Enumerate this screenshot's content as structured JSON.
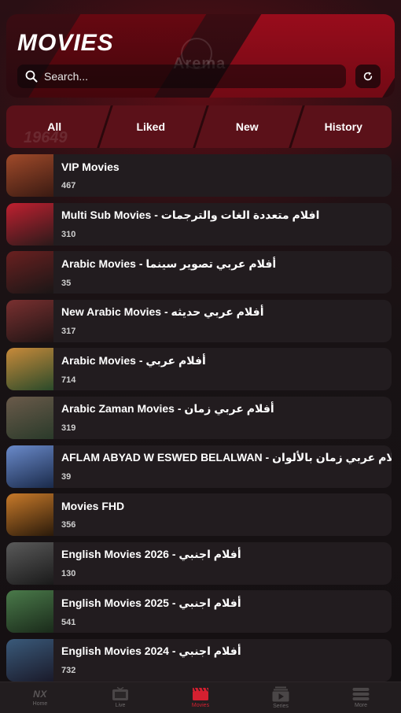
{
  "header": {
    "title": "MOVIES",
    "watermark": "Arema",
    "search_placeholder": "Search..."
  },
  "tabs": [
    {
      "label": "All"
    },
    {
      "label": "Liked"
    },
    {
      "label": "New"
    },
    {
      "label": "History"
    }
  ],
  "tabs_ghost_number": "19649",
  "categories": [
    {
      "title": "VIP Movies",
      "count": "467",
      "thumb": [
        "#3a1a12",
        "#a04a2a"
      ]
    },
    {
      "title": "Multi Sub Movies - افلام متعددة الغات والترجمات",
      "count": "310",
      "thumb": [
        "#2b1a1a",
        "#c02030"
      ]
    },
    {
      "title": "Arabic Movies - أفلام عربي تصوير سينما",
      "count": "35",
      "thumb": [
        "#1a1616",
        "#6a2020"
      ]
    },
    {
      "title": "New Arabic Movies - أفلام عربي حديثه",
      "count": "317",
      "thumb": [
        "#1e1414",
        "#7a3030"
      ]
    },
    {
      "title": "Arabic Movies - أفلام عربي",
      "count": "714",
      "thumb": [
        "#2a4a2a",
        "#c88a3a"
      ]
    },
    {
      "title": "Arabic Zaman Movies - أفلام عربي زمان",
      "count": "319",
      "thumb": [
        "#2a3a2a",
        "#6a5a4a"
      ]
    },
    {
      "title": "AFLAM ABYAD W ESWED BELALWAN - أفلام عربي زمان بالألوان",
      "count": "39",
      "thumb": [
        "#1a2a4a",
        "#6a8aca"
      ]
    },
    {
      "title": "Movies FHD",
      "count": "356",
      "thumb": [
        "#2a1a0a",
        "#c87a2a"
      ]
    },
    {
      "title": "English Movies 2026 - أفلام اجنبي",
      "count": "130",
      "thumb": [
        "#1a1a1a",
        "#5a5a5a"
      ]
    },
    {
      "title": "English Movies 2025 - أفلام اجنبي",
      "count": "541",
      "thumb": [
        "#1a2a1a",
        "#4a7a4a"
      ]
    },
    {
      "title": "English Movies 2024 - أفلام اجنبي",
      "count": "732",
      "thumb": [
        "#1a1a2a",
        "#3a5a7a"
      ]
    }
  ],
  "bottom_nav": [
    {
      "label": "Home",
      "icon": "nx-logo",
      "glyph": "NX"
    },
    {
      "label": "Live",
      "icon": "tv-icon"
    },
    {
      "label": "Movies",
      "icon": "clapperboard-icon"
    },
    {
      "label": "Series",
      "icon": "play-stack-icon"
    },
    {
      "label": "More",
      "icon": "menu-icon"
    }
  ],
  "colors": {
    "accent": "#d42030",
    "header_bg": "#3a0c12",
    "tab_bg": "#5b1119",
    "item_bg": "#221c1f"
  }
}
